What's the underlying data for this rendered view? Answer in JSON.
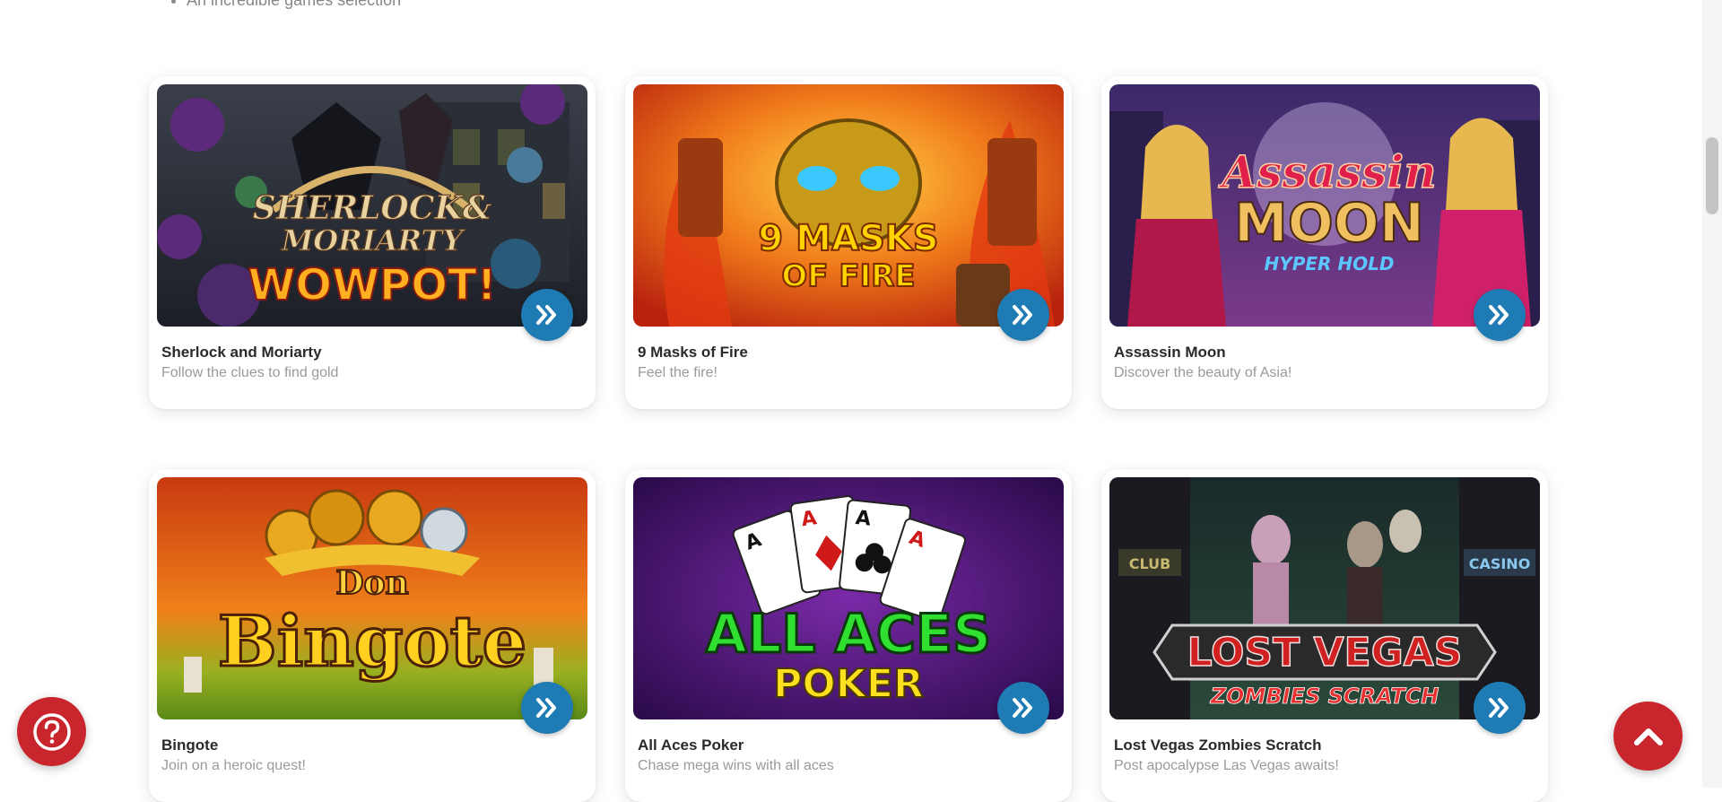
{
  "intro": {
    "partial_text": "An incredible games selection"
  },
  "games": [
    {
      "title": "Sherlock and Moriarty",
      "subtitle": "Follow the clues to find gold",
      "art_text": [
        "SHERLOCK&",
        "MORIARTY",
        "WOWPOT!"
      ]
    },
    {
      "title": "9 Masks of Fire",
      "subtitle": "Feel the fire!",
      "art_text": [
        "9 MASKS",
        "OF FIRE"
      ]
    },
    {
      "title": "Assassin Moon",
      "subtitle": "Discover the beauty of Asia!",
      "art_text": [
        "Assassin",
        "MOON",
        "HYPER HOLD"
      ]
    },
    {
      "title": "Bingote",
      "subtitle": "Join on a heroic quest!",
      "art_text": [
        "Don",
        "Bingote"
      ]
    },
    {
      "title": "All Aces Poker",
      "subtitle": "Chase mega wins with all aces",
      "art_text": [
        "ALL ACES",
        "POKER"
      ]
    },
    {
      "title": "Lost Vegas Zombies Scratch",
      "subtitle": "Post apocalypse Las Vegas awaits!",
      "art_text": [
        "LOST VEGAS",
        "ZOMBIES SCRATCH"
      ]
    }
  ],
  "icons": {
    "play": "double-chevron-right-icon",
    "help": "question-mark-icon",
    "back_to_top": "chevron-up-icon"
  },
  "colors": {
    "play_button": "#1f7bb4",
    "floating_button": "#c8262c"
  }
}
